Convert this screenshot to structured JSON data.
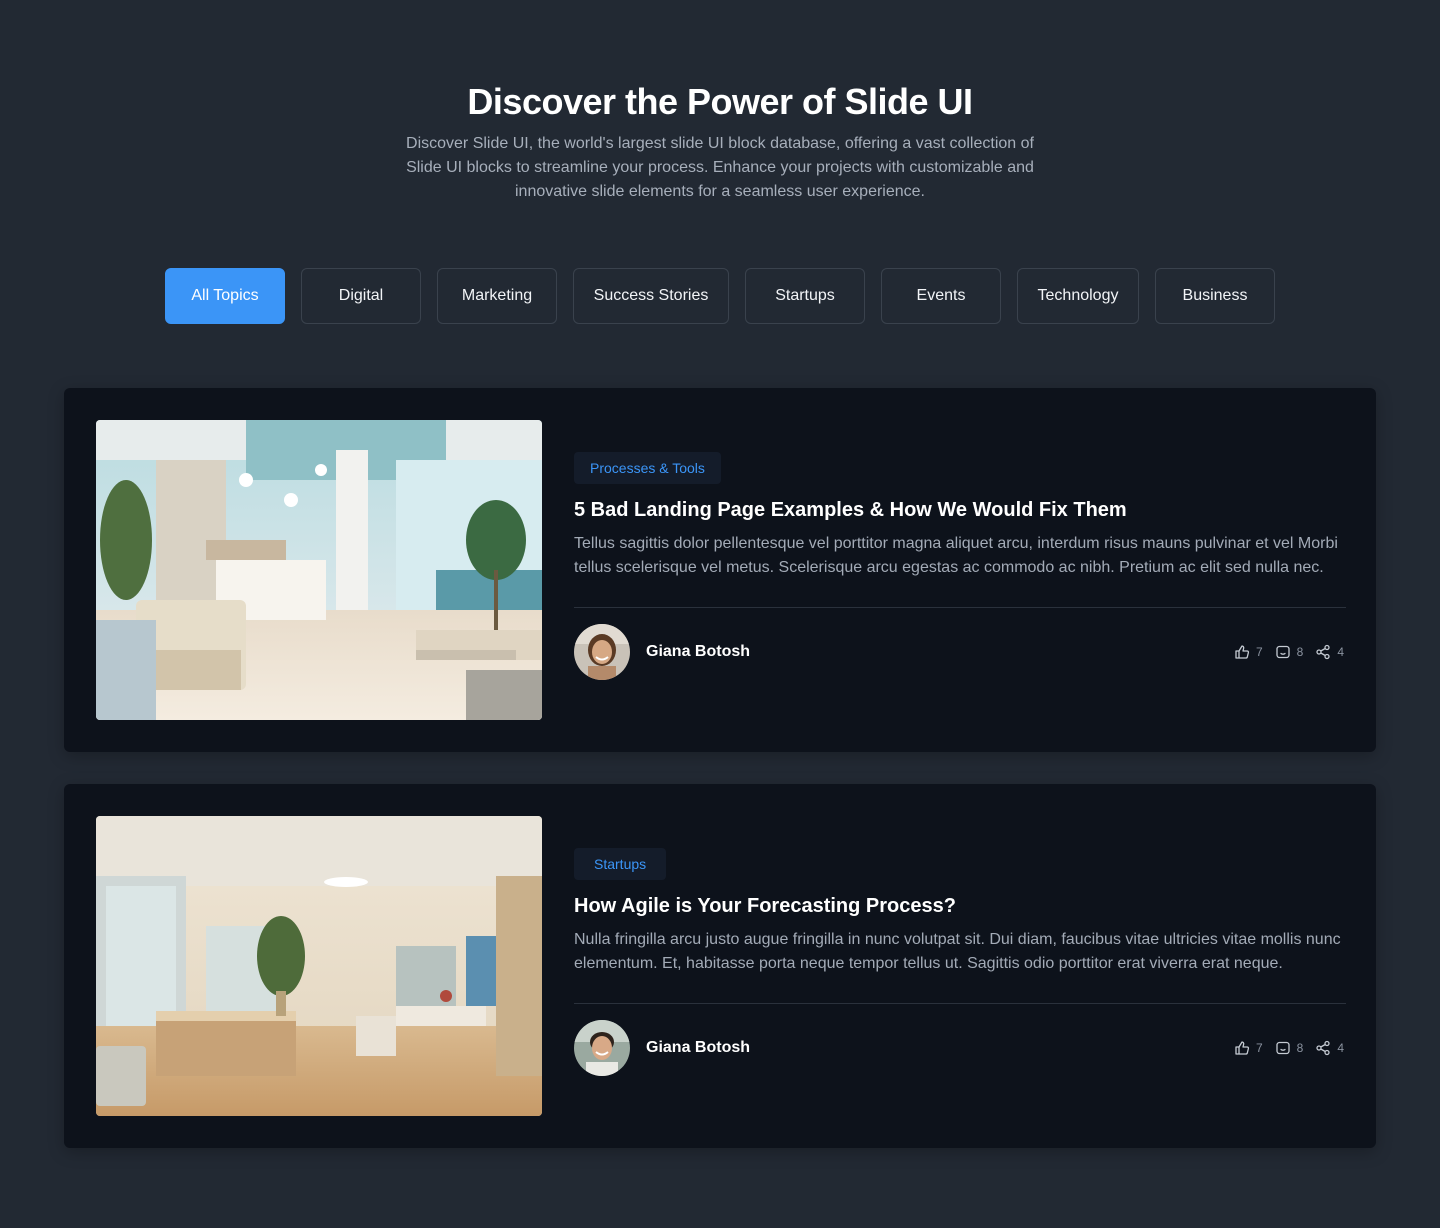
{
  "hero": {
    "title": "Discover the Power of Slide UI",
    "description": "Discover Slide UI, the world's largest slide UI block database, offering a vast collection of Slide UI blocks to streamline your process. Enhance your projects with customizable and innovative slide elements for a seamless user experience."
  },
  "filters": {
    "active": "All Topics",
    "items": [
      "All Topics",
      "Digital",
      "Marketing",
      "Success Stories",
      "Startups",
      "Events",
      "Technology",
      "Business"
    ]
  },
  "posts": [
    {
      "tag": "Processes & Tools",
      "title": "5 Bad Landing Page Examples & How We Would Fix Them",
      "excerpt": "Tellus sagittis dolor pellentesque vel porttitor magna aliquet arcu, interdum risus mauns pulvinar et vel Morbi tellus scelerisque vel metus. Scelerisque arcu egestas ac commodo ac nibh. Pretium ac elit sed nulla nec.",
      "author": "Giana Botosh",
      "likes": "7",
      "comments": "8",
      "shares": "4"
    },
    {
      "tag": "Startups",
      "title": "How Agile is Your Forecasting Process?",
      "excerpt": "Nulla fringilla arcu justo augue fringilla in nunc volutpat sit. Dui diam, faucibus vitae ultricies vitae mollis nunc elementum. Et, habitasse porta neque tempor tellus ut. Sagittis odio porttitor erat viverra erat neque.",
      "author": "Giana Botosh",
      "likes": "7",
      "comments": "8",
      "shares": "4"
    }
  ],
  "colors": {
    "background": "#222933",
    "card": "#0d121b",
    "accent": "#3b95f7"
  }
}
